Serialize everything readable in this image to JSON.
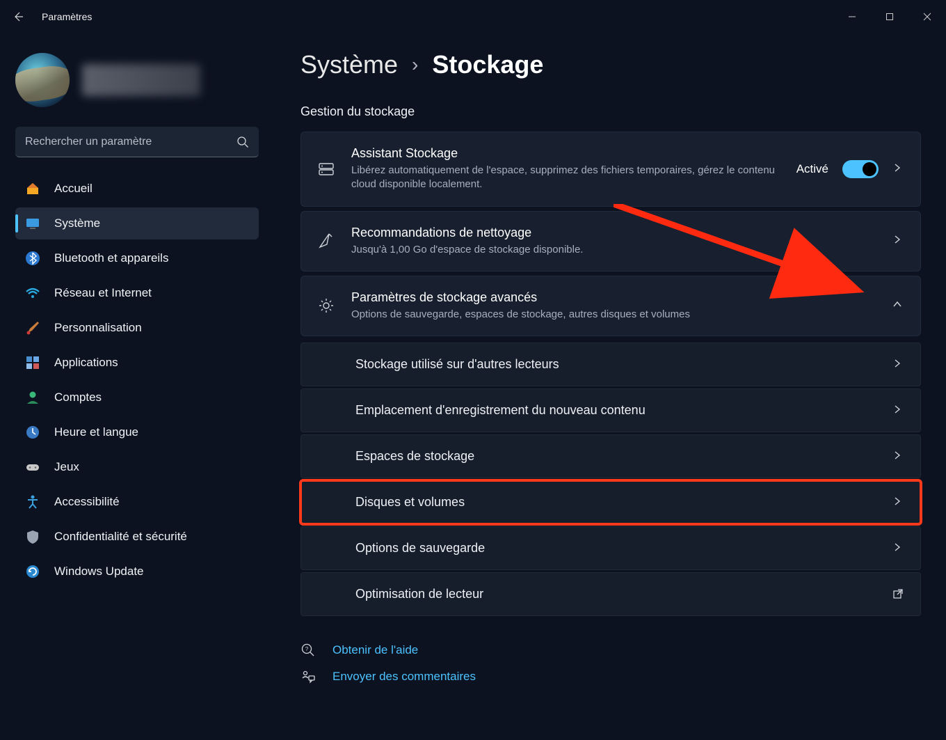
{
  "app_title": "Paramètres",
  "search": {
    "placeholder": "Rechercher un paramètre"
  },
  "sidebar": {
    "items": [
      {
        "label": "Accueil"
      },
      {
        "label": "Système"
      },
      {
        "label": "Bluetooth et appareils"
      },
      {
        "label": "Réseau et Internet"
      },
      {
        "label": "Personnalisation"
      },
      {
        "label": "Applications"
      },
      {
        "label": "Comptes"
      },
      {
        "label": "Heure et langue"
      },
      {
        "label": "Jeux"
      },
      {
        "label": "Accessibilité"
      },
      {
        "label": "Confidentialité et sécurité"
      },
      {
        "label": "Windows Update"
      }
    ]
  },
  "breadcrumb": {
    "parent": "Système",
    "current": "Stockage"
  },
  "section_title": "Gestion du stockage",
  "cards": {
    "storage_sense": {
      "title": "Assistant Stockage",
      "sub": "Libérez automatiquement de l'espace, supprimez des fichiers temporaires, gérez le contenu cloud disponible localement.",
      "toggle_label": "Activé"
    },
    "cleanup": {
      "title": "Recommandations de nettoyage",
      "sub": "Jusqu'à 1,00 Go d'espace de stockage disponible."
    },
    "advanced": {
      "title": "Paramètres de stockage avancés",
      "sub": "Options de sauvegarde, espaces de stockage, autres disques et volumes"
    }
  },
  "advanced_items": [
    "Stockage utilisé sur d'autres lecteurs",
    "Emplacement d'enregistrement du nouveau contenu",
    "Espaces de stockage",
    "Disques et volumes",
    "Options de sauvegarde",
    "Optimisation de lecteur"
  ],
  "footer": {
    "help": "Obtenir de l'aide",
    "feedback": "Envoyer des commentaires"
  }
}
